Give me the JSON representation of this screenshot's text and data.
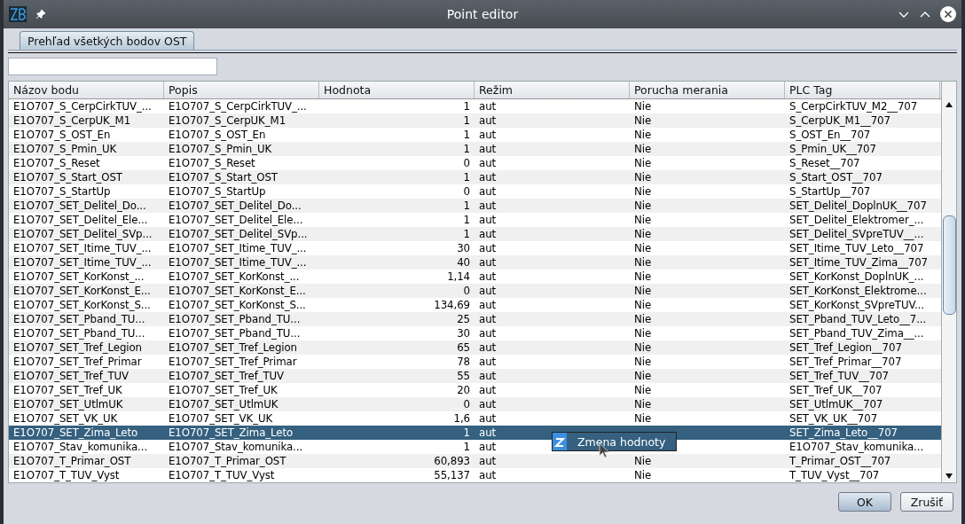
{
  "window": {
    "title": "Point editor"
  },
  "tabs": [
    {
      "label": "Prehľad všetkých bodov OST",
      "selected": true
    }
  ],
  "table": {
    "columns": [
      "Názov bodu",
      "Popis",
      "Hodnota",
      "Režim",
      "Porucha merania",
      "PLC Tag"
    ],
    "rows": [
      {
        "cells": [
          "E1O707_S_CerpCirkTUV_...",
          "E1O707_S_CerpCirkTUV_...",
          "1",
          "aut",
          "Nie",
          "S_CerpCirkTUV_M2__707"
        ],
        "selected": false
      },
      {
        "cells": [
          "E1O707_S_CerpUK_M1",
          "E1O707_S_CerpUK_M1",
          "1",
          "aut",
          "Nie",
          "S_CerpUK_M1__707"
        ],
        "selected": false
      },
      {
        "cells": [
          "E1O707_S_OST_En",
          "E1O707_S_OST_En",
          "1",
          "aut",
          "Nie",
          "S_OST_En__707"
        ],
        "selected": false
      },
      {
        "cells": [
          "E1O707_S_Pmin_UK",
          "E1O707_S_Pmin_UK",
          "1",
          "aut",
          "Nie",
          "S_Pmin_UK__707"
        ],
        "selected": false
      },
      {
        "cells": [
          "E1O707_S_Reset",
          "E1O707_S_Reset",
          "0",
          "aut",
          "Nie",
          "S_Reset__707"
        ],
        "selected": false
      },
      {
        "cells": [
          "E1O707_S_Start_OST",
          "E1O707_S_Start_OST",
          "1",
          "aut",
          "Nie",
          "S_Start_OST__707"
        ],
        "selected": false
      },
      {
        "cells": [
          "E1O707_S_StartUp",
          "E1O707_S_StartUp",
          "0",
          "aut",
          "Nie",
          "S_StartUp__707"
        ],
        "selected": false
      },
      {
        "cells": [
          "E1O707_SET_Delitel_Do...",
          "E1O707_SET_Delitel_Do...",
          "1",
          "aut",
          "Nie",
          "SET_Delitel_DoplnUK__707"
        ],
        "selected": false
      },
      {
        "cells": [
          "E1O707_SET_Delitel_Ele...",
          "E1O707_SET_Delitel_Ele...",
          "1",
          "aut",
          "Nie",
          "SET_Delitel_Elektromer_..."
        ],
        "selected": false
      },
      {
        "cells": [
          "E1O707_SET_Delitel_SVp...",
          "E1O707_SET_Delitel_SVp...",
          "1",
          "aut",
          "Nie",
          "SET_Delitel_SVpreTUV__..."
        ],
        "selected": false
      },
      {
        "cells": [
          "E1O707_SET_Itime_TUV_...",
          "E1O707_SET_Itime_TUV_...",
          "30",
          "aut",
          "Nie",
          "SET_Itime_TUV_Leto__707"
        ],
        "selected": false
      },
      {
        "cells": [
          "E1O707_SET_Itime_TUV_...",
          "E1O707_SET_Itime_TUV_...",
          "40",
          "aut",
          "Nie",
          "SET_Itime_TUV_Zima__707"
        ],
        "selected": false
      },
      {
        "cells": [
          "E1O707_SET_KorKonst_...",
          "E1O707_SET_KorKonst_...",
          "1,14",
          "aut",
          "Nie",
          "SET_KorKonst_DoplnUK_..."
        ],
        "selected": false
      },
      {
        "cells": [
          "E1O707_SET_KorKonst_E...",
          "E1O707_SET_KorKonst_E...",
          "0",
          "aut",
          "Nie",
          "SET_KorKonst_Elektrome..."
        ],
        "selected": false
      },
      {
        "cells": [
          "E1O707_SET_KorKonst_S...",
          "E1O707_SET_KorKonst_S...",
          "134,69",
          "aut",
          "Nie",
          "SET_KorKonst_SVpreTUV..."
        ],
        "selected": false
      },
      {
        "cells": [
          "E1O707_SET_Pband_TU...",
          "E1O707_SET_Pband_TU...",
          "25",
          "aut",
          "Nie",
          "SET_Pband_TUV_Leto__7..."
        ],
        "selected": false
      },
      {
        "cells": [
          "E1O707_SET_Pband_TU...",
          "E1O707_SET_Pband_TU...",
          "30",
          "aut",
          "Nie",
          "SET_Pband_TUV_Zima__..."
        ],
        "selected": false
      },
      {
        "cells": [
          "E1O707_SET_Tref_Legion",
          "E1O707_SET_Tref_Legion",
          "65",
          "aut",
          "Nie",
          "SET_Tref_Legion__707"
        ],
        "selected": false
      },
      {
        "cells": [
          "E1O707_SET_Tref_Primar",
          "E1O707_SET_Tref_Primar",
          "78",
          "aut",
          "Nie",
          "SET_Tref_Primar__707"
        ],
        "selected": false
      },
      {
        "cells": [
          "E1O707_SET_Tref_TUV",
          "E1O707_SET_Tref_TUV",
          "55",
          "aut",
          "Nie",
          "SET_Tref_TUV__707"
        ],
        "selected": false
      },
      {
        "cells": [
          "E1O707_SET_Tref_UK",
          "E1O707_SET_Tref_UK",
          "20",
          "aut",
          "Nie",
          "SET_Tref_UK__707"
        ],
        "selected": false
      },
      {
        "cells": [
          "E1O707_SET_UtlmUK",
          "E1O707_SET_UtlmUK",
          "0",
          "aut",
          "Nie",
          "SET_UtlmUK__707"
        ],
        "selected": false
      },
      {
        "cells": [
          "E1O707_SET_VK_UK",
          "E1O707_SET_VK_UK",
          "1,6",
          "aut",
          "Nie",
          "SET_VK_UK__707"
        ],
        "selected": false
      },
      {
        "cells": [
          "E1O707_SET_Zima_Leto",
          "E1O707_SET_Zima_Leto",
          "1",
          "aut",
          "",
          "SET_Zima_Leto__707"
        ],
        "selected": true
      },
      {
        "cells": [
          "E1O707_Stav_komunika...",
          "E1O707_Stav_komunika...",
          "1",
          "aut",
          "",
          "E1O707_Stav_komunika..."
        ],
        "selected": false
      },
      {
        "cells": [
          "E1O707_T_Primar_OST",
          "E1O707_T_Primar_OST",
          "60,893",
          "aut",
          "Nie",
          "T_Primar_OST__707"
        ],
        "selected": false
      },
      {
        "cells": [
          "E1O707_T_TUV_Vyst",
          "E1O707_T_TUV_Vyst",
          "55,137",
          "aut",
          "Nie",
          "T_TUV_Vyst__707"
        ],
        "selected": false
      }
    ]
  },
  "context_menu": {
    "items": [
      {
        "label": "Zmena hodnoty"
      }
    ]
  },
  "buttons": [
    {
      "label": "OK",
      "kind": "default"
    },
    {
      "label": "Zrušiť",
      "kind": "normal"
    }
  ]
}
